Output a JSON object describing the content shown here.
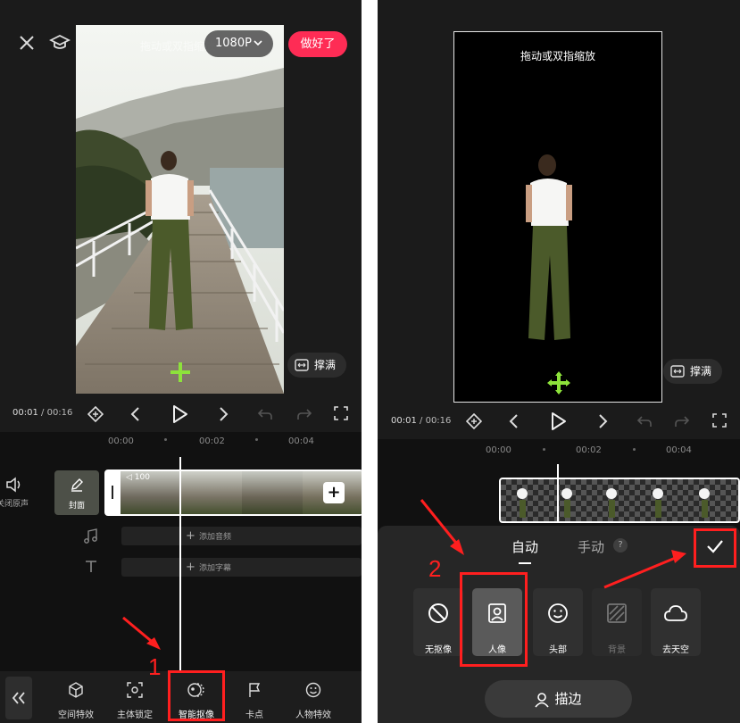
{
  "left": {
    "resolution": "1080P",
    "done_button": "做好了",
    "fill_button": "撑满",
    "time_current": "00:01",
    "time_separator": "/",
    "time_total": "00:16",
    "timeline_ticks": [
      "00:00",
      "00:02",
      "00:04"
    ],
    "mute_label": "关闭原声",
    "cover_label": "封面",
    "clip_volume": "100",
    "add_audio": "添加音频",
    "add_caption": "添加字幕",
    "tools": [
      "空间特效",
      "主体锁定",
      "智能抠像",
      "卡点",
      "人物特效"
    ],
    "annotation": "1",
    "colors": {
      "accent": "#fe2c55",
      "annotation": "#ff1f1f",
      "marker": "#8de23b"
    }
  },
  "right": {
    "hint": "拖动或双指缩放",
    "fill_button": "撑满",
    "time_current": "00:01",
    "time_separator": "/",
    "time_total": "00:16",
    "timeline_ticks": [
      "00:00",
      "00:02",
      "00:04"
    ],
    "tabs": [
      "自动",
      "手动"
    ],
    "help": "?",
    "options": [
      "无抠像",
      "人像",
      "头部",
      "背景",
      "去天空"
    ],
    "outline_button": "描边",
    "annotation": "2"
  }
}
